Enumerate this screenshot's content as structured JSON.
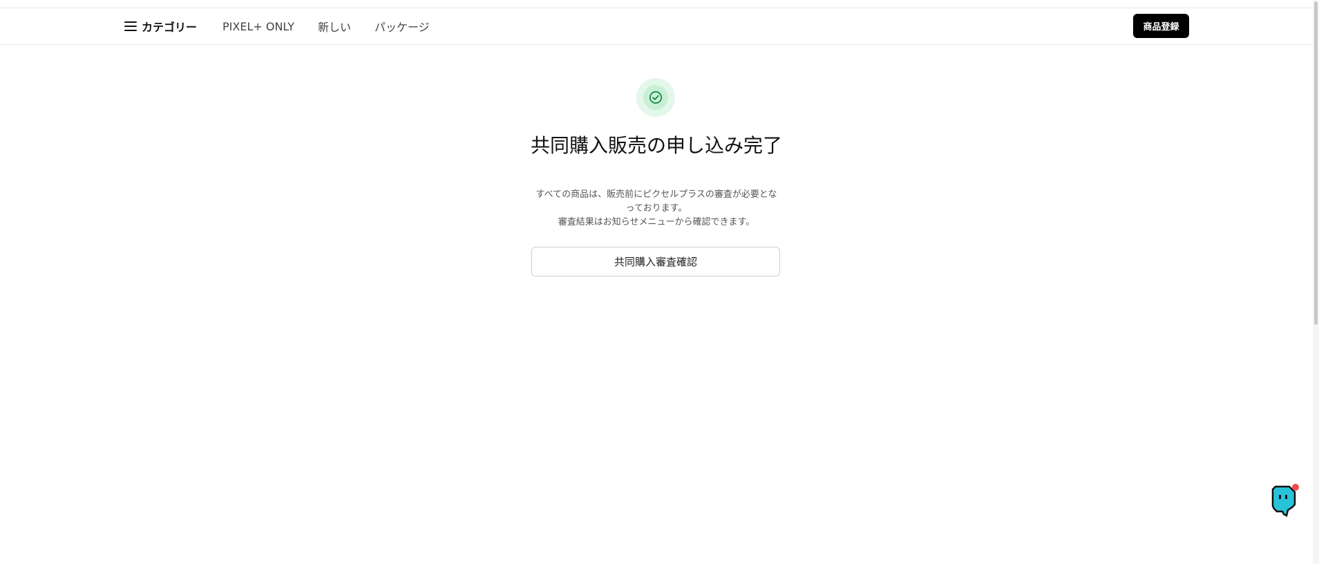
{
  "nav": {
    "menu_label": "カテゴリー",
    "links": [
      "PIXEL+ ONLY",
      "新しい",
      "パッケージ"
    ],
    "register_label": "商品登録"
  },
  "main": {
    "title": "共同購入販売の申し込み完了",
    "desc_line1": "すべての商品は、販売前にピクセルプラスの審査が必要とな",
    "desc_line2": "っております。",
    "desc_line3": "審査結果はお知らせメニューから確認できます。",
    "confirm_label": "共同購入審査確認"
  },
  "icons": {
    "menu": "hamburger-icon",
    "success": "check-circle-icon",
    "chat": "chat-mascot-icon"
  },
  "colors": {
    "success_green": "#1aa34a",
    "success_bg": "#e3f7ea",
    "chat_teal": "#29c3d9",
    "notification_dot": "#f04a4a",
    "primary_button": "#000000"
  }
}
